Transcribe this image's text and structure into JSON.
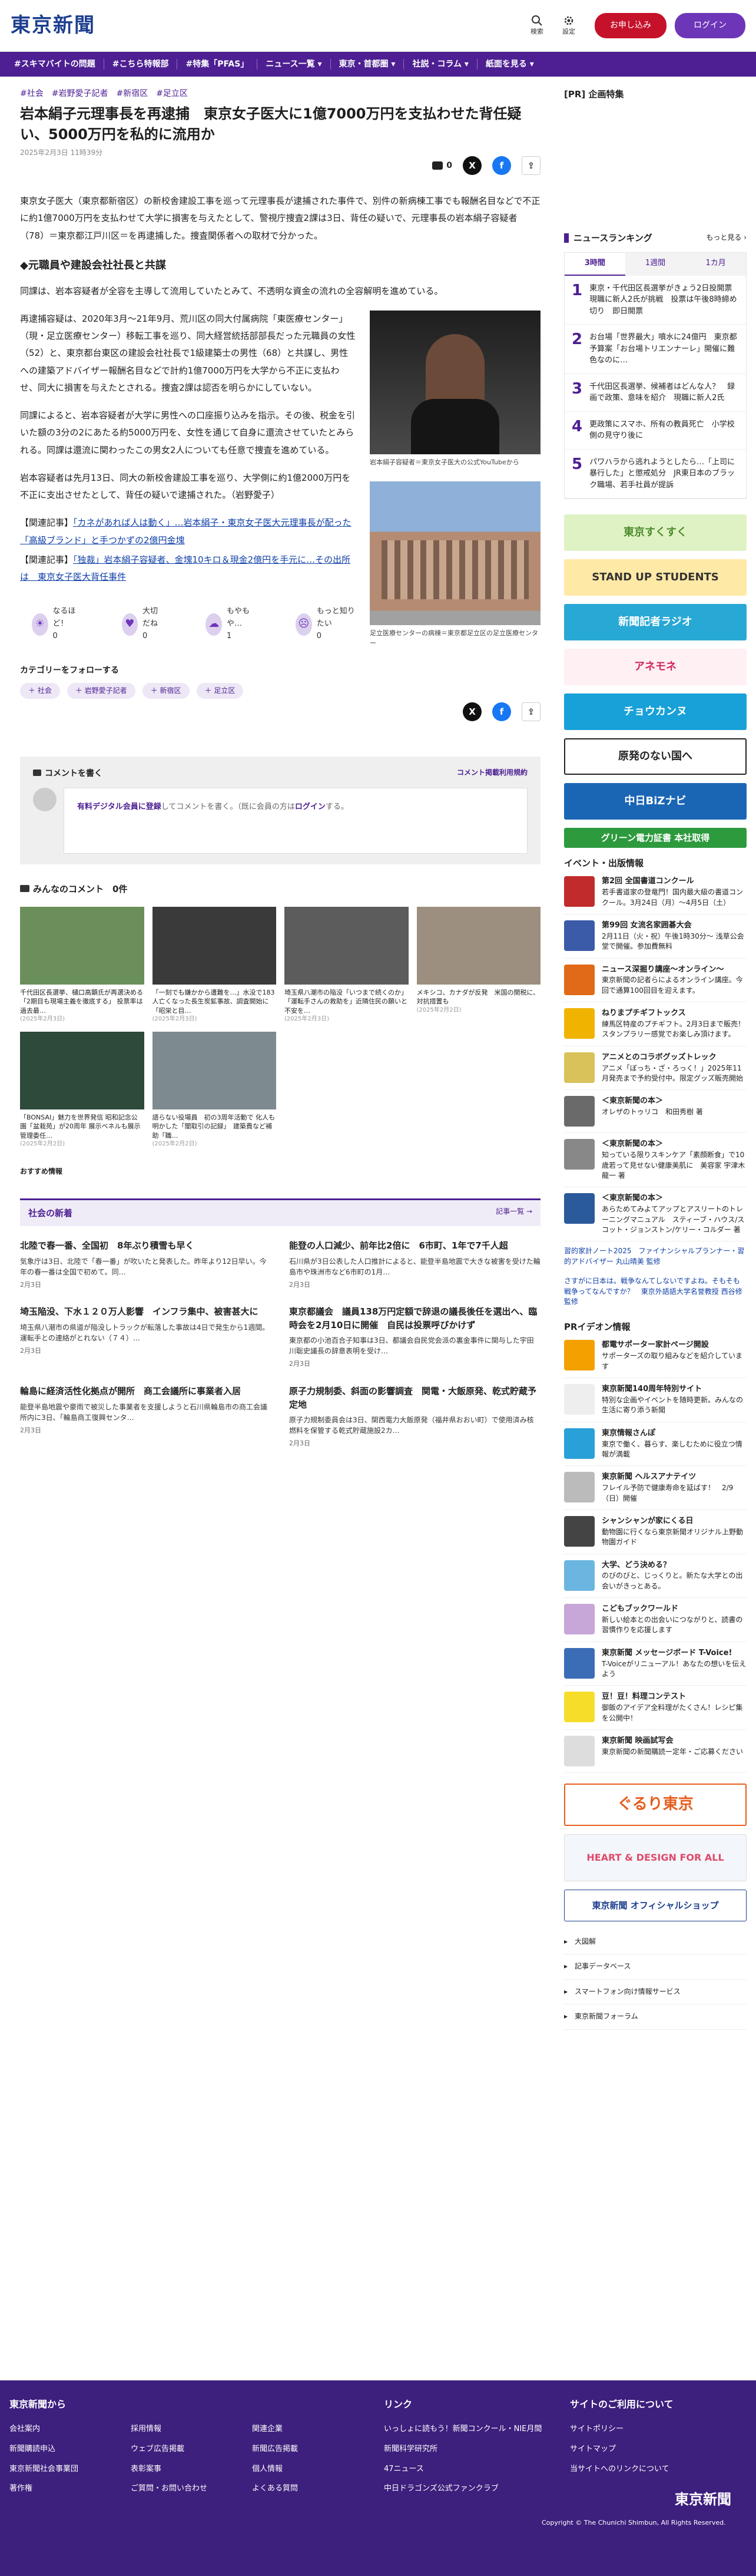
{
  "header": {
    "logo": "東京新聞",
    "search": "検索",
    "settings": "設定",
    "subscribe": "お申し込み",
    "login": "ログイン"
  },
  "nav": [
    "#スキマバイトの問題",
    "#こちら特報部",
    "#特集「PFAS」",
    "ニュース一覧 ▾",
    "東京・首都圏 ▾",
    "社説・コラム ▾",
    "紙面を見る ▾"
  ],
  "article": {
    "tags": [
      "#社会",
      "#岩野愛子記者",
      "#新宿区",
      "#足立区"
    ],
    "title": "岩本絹子元理事長を再逮捕　東京女子医大に1億7000万円を支払わせた背任疑い、5000万円を私的に流用か",
    "date": "2025年2月3日 11時39分",
    "comment_count": "0",
    "lead": "東京女子医大（東京都新宿区）の新校舎建設工事を巡って元理事長が逮捕された事件で、別件の新病棟工事でも報酬名目などで不正に約1億7000万円を支払わせて大学に損害を与えたとして、警視庁捜査2課は3日、背任の疑いで、元理事長の岩本絹子容疑者（78）＝東京都江戸川区＝を再逮捕した。捜査関係者への取材で分かった。",
    "h2": "◆元職員や建設会社社長と共謀",
    "p1": "同課は、岩本容疑者が全容を主導して流用していたとみて、不透明な資金の流れの全容解明を進めている。",
    "p2": "再逮捕容疑は、2020年3月〜21年9月、荒川区の同大付属病院「東医療センター」（現・足立医療センター）移転工事を巡り、同大経営統括部部長だった元職員の女性（52）と、東京都台東区の建設会社社長で1級建築士の男性（68）と共謀し、男性への建築アドバイザー報酬名目などで計約1億7000万円を大学から不正に支払わせ、同大に損害を与えたとされる。捜査2課は認否を明らかにしていない。",
    "p3": "同課によると、岩本容疑者が大学に男性への口座振り込みを指示。その後、税金を引いた額の3分の2にあたる約5000万円を、女性を通じて自身に還流させていたとみられる。同課は還流に関わったこの男女2人についても任意で捜査を進めている。",
    "p4": "岩本容疑者は先月13日、同大の新校舎建設工事を巡り、大学側に約1億2000万円を不正に支出させたとして、背任の疑いで逮捕された。（岩野愛子）",
    "rel1_label": "【関連記事】",
    "rel1": "「カネがあれば人は動く」…岩本絹子・東京女子医大元理事長が配った「高級ブランド」と手つかずの2億円金塊",
    "rel2_label": "【関連記事】",
    "rel2": "「独裁」岩本絹子容疑者、金塊10キロ＆現金2億円を手元に…その出所は　東京女子医大背任事件",
    "cap1": "岩本絹子容疑者＝東京女子医大の公式YouTubeから",
    "cap2": "足立医療センターの病棟＝東京都足立区の足立医療センター"
  },
  "reactions": [
    {
      "label": "なるほど！",
      "count": "0"
    },
    {
      "label": "大切だね",
      "count": "0"
    },
    {
      "label": "もやもや…",
      "count": "1"
    },
    {
      "label": "もっと知りたい",
      "count": "0"
    }
  ],
  "follow": {
    "title": "カテゴリーをフォローする",
    "items": [
      "社会",
      "岩野愛子記者",
      "新宿区",
      "足立区"
    ]
  },
  "comment": {
    "title": "コメントを書く",
    "policy": "コメント掲載利用規約",
    "register": "有料デジタル会員に登録",
    "placeholder": "してコメントを書く。（既に会員の方は",
    "login": "ログイン",
    "end": "する。"
  },
  "everyone": {
    "title": "みんなのコメント",
    "count": "0件"
  },
  "thumbs": [
    {
      "t": "千代田区長選挙、樋口高顕氏が再選決める「2期目も現場主義を徹底する」 投票率は過去最…",
      "d": "(2025年2月3日)",
      "c": "#6b8f5a"
    },
    {
      "t": "「一刻でも嫌かから遭難を…」水没で183人亡くなった長生炭鉱事故、調査開始に「昭栄と目…",
      "d": "(2025年2月3日)",
      "c": "#3a3a3a"
    },
    {
      "t": "埼玉県八潮市の陥没「いつまで続くのか」「運転手さんの救助を」近隣住民の願いと不安を…",
      "d": "(2025年2月3日)",
      "c": "#5c5c5c"
    },
    {
      "t": "メキシコ、カナダが反発　米国の関税に、対抗措置も",
      "d": "(2025年2月2日)",
      "c": "#9c8f7f"
    },
    {
      "t": "「BONSAI」魅力を世界発信 昭和記念公園「盆栽苑」が20周年 展示ベネルも展示　管理委任…",
      "d": "(2025年2月2日)",
      "c": "#2d4a3a"
    },
    {
      "t": "語らない役場員　初の3周年活動で 化人も明かした「闇取引の記録」　建築費など補助「職…",
      "d": "(2025年2月2日)",
      "c": "#7d8a8f"
    }
  ],
  "recommend": "おすすめ情報",
  "news": {
    "title": "社会の新着",
    "more": "記事一覧 →",
    "items": [
      {
        "h": "北陸で春一番、全国初　8年ぶり積雪も早く",
        "p": "気象庁は3日、北陸で「春一番」が吹いたと発表した。昨年より12日早い。今年の春一番は全国で初めて。同…",
        "d": "2月3日"
      },
      {
        "h": "能登の人口減少、前年比2倍に　6市町、1年で7千人超",
        "p": "石川県が3日公表した人口推計によると、能登半島地震で大きな被害を受けた輪島市や珠洲市など6市町の1月…",
        "d": "2月3日"
      },
      {
        "h": "埼玉陥没、下水１２０万人影響　インフラ集中、被害甚大に",
        "p": "埼玉県八潮市の県道が陥没しトラックが転落した事故は4日で発生から1週間。運転手との連絡がとれない（７４）…",
        "d": "2月3日"
      },
      {
        "h": "東京都議会　議員138万円定額で辞退の議長後任を選出へ、臨時会を2月10日に開催　自民は投票呼びかけず",
        "p": "東京都の小池百合子知事は3日、都議会自民党会派の裏金事件に関与した宇田川聡史議長の辞意表明を受け…",
        "d": "2月3日"
      },
      {
        "h": "輪島に経済活性化拠点が開所　商工会議所に事業者入居",
        "p": "能登半島地震や豪雨で被災した事業者を支援しようと石川県輪島市の商工会議所内に3日、「輪島商工復興センタ…",
        "d": "2月3日"
      },
      {
        "h": "原子力規制委、斜面の影響調査　関電・大飯原発、乾式貯蔵予定地",
        "p": "原子力規制委員会は3日、関西電力大飯原発（福井県おおい町）で使用済み核燃料を保管する乾式貯蔵施設2カ…",
        "d": "2月3日"
      }
    ]
  },
  "side": {
    "pr_title": "[PR] 企画特集",
    "ranking_title": "ニュースランキング",
    "ranking_more": "もっと見る ›",
    "tabs": [
      "3時間",
      "1週間",
      "1カ月"
    ],
    "ranks": [
      {
        "n": "1",
        "t": "東京・千代田区長選挙がきょう2日投開票　現職に新人2氏が挑戦　投票は午後8時締め切り　即日開票"
      },
      {
        "n": "2",
        "t": "お台場「世界最大」噴水に24億円　東京都予算案「お台場トリエンナーレ」開催に難色なのに…"
      },
      {
        "n": "3",
        "t": "千代田区長選挙、候補者はどんな人？　録画で政策、意味を紹介　現職に新人2氏"
      },
      {
        "n": "4",
        "t": "更政策にスマホ、所有の教員死亡　小学校側の見守り後に"
      },
      {
        "n": "5",
        "t": "パワハラから逃れようとしたら…「上司に暴行した」と懲戒処分　JR東日本のブラック職場、若手社員が提訴"
      }
    ],
    "banners": [
      {
        "t": "東京すくすく",
        "bg": "#dff2c4",
        "c": "#4b8a2a"
      },
      {
        "t": "STAND UP STUDENTS",
        "bg": "#ffe9a6",
        "c": "#333"
      },
      {
        "t": "新聞記者ラジオ",
        "bg": "#28a8d4",
        "c": "#fff"
      },
      {
        "t": "アネモネ",
        "bg": "#fff0f3",
        "c": "#d1275d"
      },
      {
        "t": "チョウカンヌ",
        "bg": "#17a1d8",
        "c": "#fff"
      },
      {
        "t": "原発のない国へ",
        "bg": "#fff",
        "c": "#222"
      },
      {
        "t": "中日BiZナビ",
        "bg": "#1a66b5",
        "c": "#fff"
      },
      {
        "t": "グリーン電力証書 本社取得",
        "bg": "#2d9a3d",
        "c": "#fff"
      }
    ],
    "events_title": "イベント・出版情報",
    "events": [
      {
        "b": "第2回 全国書道コンクール",
        "p": "若手書道家の登竜門！国内最大級の書道コンクール。3月24日（月）〜4月5日（土）",
        "c": "#c22b2b"
      },
      {
        "b": "第99回 女流名家囲碁大会",
        "p": "2月11日（火・祝）午後1時30分〜 浅草公会堂で開催。参加費無料",
        "c": "#3b5aa8"
      },
      {
        "b": "ニュース深掘り講座〜オンライン〜",
        "p": "東京新聞の記者らによるオンライン講座。今回で通算100回目を迎えます。",
        "c": "#e06a18"
      },
      {
        "b": "ねりまプチギフトックス",
        "p": "練馬区特産のプチギフト。2月3日まで販売！スタンプラリー感覚でお楽しみ頂けます。",
        "c": "#f0b400"
      },
      {
        "b": "アニメとのコラボグッズトレック",
        "p": "アニメ「ぼっち・ざ・ろっく！」2025年11月発売まで予約受付中。限定グッズ販売開始",
        "c": "#d9c25a"
      },
      {
        "b": "＜東京新聞の本＞",
        "p": "オレザのトゥリコ　和田秀樹 著",
        "c": "#6a6a6a"
      },
      {
        "b": "＜東京新聞の本＞",
        "p": "知っている限りスキンケア「素顔断食」で10歳若って見せない健康美肌に　美容家 宇津木龍一 著",
        "c": "#888"
      },
      {
        "b": "＜東京新聞の本＞",
        "p": "あらためてみよてアップとアスリートのトレーニングマニュアル　スティーブ・ハウス/スコット・ジョンストン/ケリー・コルダー 著",
        "c": "#2a5a9a"
      }
    ],
    "text_ads": [
      "習的家計ノート2025　ファイナンシャルプランナー・習的アドバイザー 丸山晴美 監修",
      "さすがに日本は。戦争なんてしないですよね。そもそも戦争ってなんですか？　東京外語語大学名誉教授 西谷修 監修"
    ],
    "pr_title2": "PRイデオン情報",
    "pr": [
      {
        "b": "都電サポーター家計ページ開設",
        "p": "サポーターズの取り組みなどを紹介しています",
        "c": "#f4a000"
      },
      {
        "b": "東京新聞140周年特別サイト",
        "p": "特別な企画やイベントを随時更新。みんなの生活に寄り添う新聞",
        "c": "#eee"
      },
      {
        "b": "東京情報さんぽ",
        "p": "東京で働く、暮らす、楽しむために役立つ情報が満載",
        "c": "#29a0d8"
      },
      {
        "b": "東京新聞 ヘルスアナテイツ",
        "p": "フレイル予防で健康寿命を延ばす！　2/9（日）開催",
        "c": "#bbb"
      },
      {
        "b": "シャンシャンが家にくる日",
        "p": "動物園に行くなら東京新聞オリジナル上野動物園ガイド",
        "c": "#444"
      },
      {
        "b": "大学、どう決める？",
        "p": "のびのびと、じっくりと。新たな大学との出会いがきっとある。",
        "c": "#6bb6e0"
      },
      {
        "b": "こどもブックワールド",
        "p": "新しい絵本との出会いにつながりと、読書の習慣作りを応援します",
        "c": "#c7a6d8"
      },
      {
        "b": "東京新聞 メッセージボード T-Voice!",
        "p": "T-Voiceがリニューアル！あなたの想いを伝えよう",
        "c": "#3b6db6"
      },
      {
        "b": "豆！豆！料理コンテスト",
        "p": "御飯のアイデア全料理がたくさん！レシピ集を公開中！",
        "c": "#f6dd2a"
      },
      {
        "b": "東京新聞 映画試写会",
        "p": "東京新聞の新聞購読ー定年・ご応募ください",
        "c": "#ddd"
      }
    ],
    "big_ads": [
      "ぐるり東京",
      "HEART & DESIGN FOR ALL",
      "東京新聞 オフィシャルショップ"
    ],
    "links": [
      "大図解",
      "記事データベース",
      "スマートフォン向け情報サービス",
      "東京新聞フォーラム"
    ]
  },
  "footer": {
    "h1": "東京新聞から",
    "c1": [
      "会社案内",
      "新聞購読申込",
      "東京新聞社会事業団",
      "著作権"
    ],
    "c2": [
      "採用情報",
      "ウェブ広告掲載",
      "表彰案事",
      "ご質問・お問い合わせ"
    ],
    "c3": [
      "関連企業",
      "新聞広告掲載",
      "個人情報",
      "よくある質問"
    ],
    "h2": "リンク",
    "c4": [
      "いっしょに読もう！新聞コンクール・NIE月間",
      "新聞科学研究所",
      "47ニュース",
      "中日ドラゴンズ公式ファンクラブ"
    ],
    "h3": "サイトのご利用について",
    "c5": [
      "サイトポリシー",
      "サイトマップ",
      "当サイトへのリンクについて"
    ],
    "logo": "東京新聞",
    "copy": "Copyright © The Chunichi Shimbun, All Rights Reserved."
  }
}
